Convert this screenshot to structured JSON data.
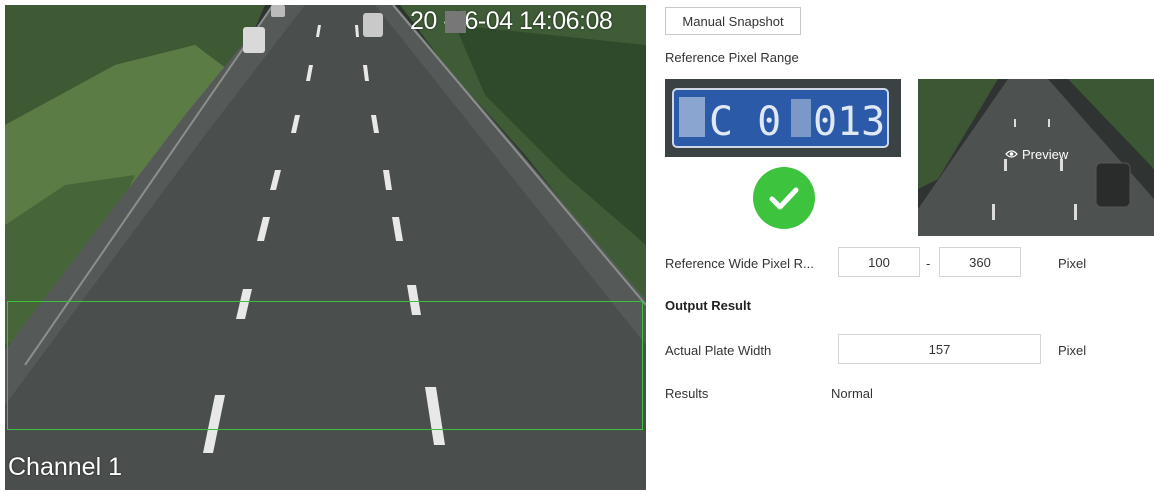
{
  "video": {
    "osd_time": "20  -06-04 14:06:08",
    "channel_label": "Channel 1"
  },
  "panel": {
    "snapshot_button": "Manual Snapshot",
    "reference_pixel_range_label": "Reference Pixel Range",
    "plate_text": "■C 0■013",
    "preview_label": "Preview",
    "reference_wide_label": "Reference Wide Pixel R...",
    "range_min": "100",
    "range_separator": "-",
    "range_max": "360",
    "range_unit": "Pixel",
    "output_result_heading": "Output Result",
    "actual_plate_width_label": "Actual Plate Width",
    "actual_plate_width_value": "157",
    "actual_plate_width_unit": "Pixel",
    "results_label": "Results",
    "results_value": "Normal"
  },
  "colors": {
    "roi_box": "#3dc03d",
    "check_circle": "#3ec33e"
  },
  "icons": [
    "check-icon",
    "eye-icon"
  ]
}
